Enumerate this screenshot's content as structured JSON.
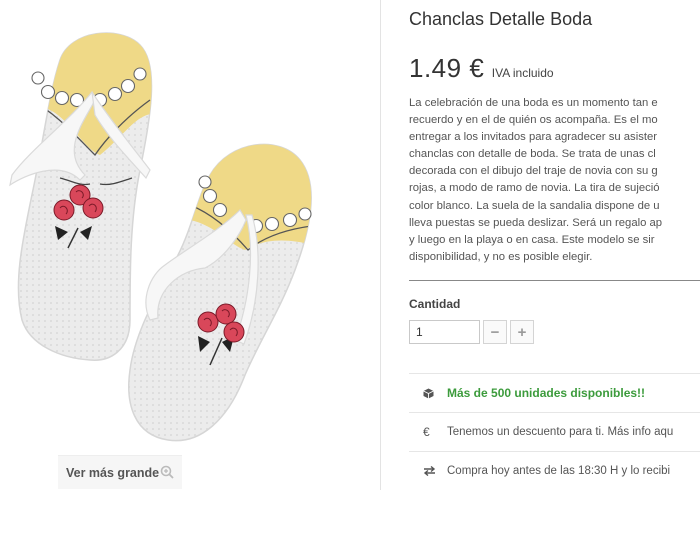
{
  "product": {
    "title": "Chanclas Detalle Boda",
    "price": "1.49 €",
    "tax_note": "IVA incluido",
    "description_lines": [
      "La celebración de una boda es un momento tan e",
      "recuerdo y en el de quién os acompaña. Es el mo",
      "entregar a los invitados para agradecer su asister",
      "chanclas con detalle de boda. Se trata de unas cl",
      "decorada con el dibujo del traje de novia con su g",
      "rojas, a modo de ramo de novia. La tira de sujeció",
      "color blanco. La suela de la sandalia dispone de u",
      "lleva puestas se pueda deslizar. Será un regalo ap",
      "y luego en la playa o en casa. Este modelo se sir",
      "disponibilidad, y no es posible elegir."
    ]
  },
  "image": {
    "zoom_label": "Ver más grande",
    "zoom_icon": "zoom-in-icon"
  },
  "quantity": {
    "label": "Cantidad",
    "value": "1",
    "minus_label": "−",
    "plus_label": "+"
  },
  "info": {
    "stock": "Más de 500 unidades disponibles!!",
    "offer": "Tenemos un descuento para ti. Más info aqu",
    "shipping": "Compra hoy antes de las 18:30 H y lo recibi"
  },
  "colors": {
    "stock_green": "#3c9b3c",
    "dress_yellow": "#efd987",
    "rose_red": "#d9475a",
    "sandal_white": "#ececec"
  }
}
